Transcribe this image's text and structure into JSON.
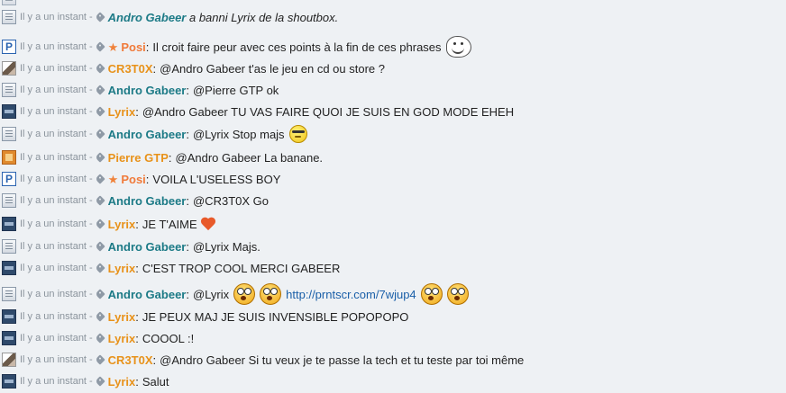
{
  "shoutbox": {
    "messages": [
      {
        "id": "r0",
        "avatar": "andro",
        "time": "Il y a un instant",
        "star": false,
        "user": "Andro Gabeer",
        "user_class": "u-andro",
        "italic": true,
        "text": "a banni Lyrix de la shoutbox.",
        "parts": []
      },
      {
        "id": "r1",
        "avatar": "posi",
        "time": "Il y a un instant",
        "star": true,
        "user": "Posi",
        "user_class": "u-posi",
        "italic": false,
        "text": "Il croit faire peur avec ces points à la fin de ces phrases",
        "parts": [
          {
            "type": "emoji",
            "icon": "troll-face-icon"
          }
        ]
      },
      {
        "id": "r2",
        "avatar": "cr3t0x",
        "time": "Il y a un instant",
        "star": false,
        "user": "CR3T0X",
        "user_class": "u-cr3t0x",
        "italic": false,
        "text": "@Andro Gabeer t'as le jeu en cd ou store ?",
        "parts": []
      },
      {
        "id": "r3",
        "avatar": "andro",
        "time": "Il y a un instant",
        "star": false,
        "user": "Andro Gabeer",
        "user_class": "u-andro",
        "italic": false,
        "text": "@Pierre GTP ok",
        "parts": []
      },
      {
        "id": "r4",
        "avatar": "lyrix",
        "time": "Il y a un instant",
        "star": false,
        "user": "Lyrix",
        "user_class": "u-lyrix",
        "italic": false,
        "text": "@Andro Gabeer TU VAS FAIRE QUOI JE SUIS EN GOD MODE EHEH",
        "parts": []
      },
      {
        "id": "r5",
        "avatar": "andro",
        "time": "Il y a un instant",
        "star": false,
        "user": "Andro Gabeer",
        "user_class": "u-andro",
        "italic": false,
        "text": "@Lyrix Stop majs",
        "parts": [
          {
            "type": "emoji",
            "icon": "cool-smiley-icon"
          }
        ]
      },
      {
        "id": "r6",
        "avatar": "pierre",
        "time": "Il y a un instant",
        "star": false,
        "user": "Pierre GTP",
        "user_class": "u-pierre",
        "italic": false,
        "text": "@Andro Gabeer La banane.",
        "parts": []
      },
      {
        "id": "r7",
        "avatar": "posi",
        "time": "Il y a un instant",
        "star": true,
        "user": "Posi",
        "user_class": "u-posi",
        "italic": false,
        "text": "VOILA L'USELESS BOY",
        "parts": []
      },
      {
        "id": "r8",
        "avatar": "andro",
        "time": "Il y a un instant",
        "star": false,
        "user": "Andro Gabeer",
        "user_class": "u-andro",
        "italic": false,
        "text": "@CR3T0X Go",
        "parts": []
      },
      {
        "id": "r9",
        "avatar": "lyrix",
        "time": "Il y a un instant",
        "star": false,
        "user": "Lyrix",
        "user_class": "u-lyrix",
        "italic": false,
        "text": "JE T'AIME",
        "parts": [
          {
            "type": "emoji",
            "icon": "heart-icon"
          }
        ]
      },
      {
        "id": "r10",
        "avatar": "andro",
        "time": "Il y a un instant",
        "star": false,
        "user": "Andro Gabeer",
        "user_class": "u-andro",
        "italic": false,
        "text": "@Lyrix Majs.",
        "parts": []
      },
      {
        "id": "r11",
        "avatar": "lyrix",
        "time": "Il y a un instant",
        "star": false,
        "user": "Lyrix",
        "user_class": "u-lyrix",
        "italic": false,
        "text": "C'EST TROP COOL MERCI GABEER",
        "parts": []
      },
      {
        "id": "r12",
        "avatar": "andro",
        "time": "Il y a un instant",
        "star": false,
        "user": "Andro Gabeer",
        "user_class": "u-andro",
        "italic": false,
        "text": "@Lyrix",
        "parts": [
          {
            "type": "emoji",
            "icon": "shocked-smiley-icon"
          },
          {
            "type": "emoji",
            "icon": "shocked-smiley-icon"
          },
          {
            "type": "link",
            "text": "http://prntscr.com/7wjup4"
          },
          {
            "type": "emoji",
            "icon": "shocked-smiley-icon"
          },
          {
            "type": "emoji",
            "icon": "shocked-smiley-icon"
          }
        ]
      },
      {
        "id": "r13",
        "avatar": "lyrix",
        "time": "Il y a un instant",
        "star": false,
        "user": "Lyrix",
        "user_class": "u-lyrix",
        "italic": false,
        "text": "JE PEUX MAJ JE SUIS INVENSIBLE POPOPOPO",
        "parts": []
      },
      {
        "id": "r14",
        "avatar": "lyrix",
        "time": "Il y a un instant",
        "star": false,
        "user": "Lyrix",
        "user_class": "u-lyrix",
        "italic": false,
        "text": "COOOL :!",
        "parts": []
      },
      {
        "id": "r15",
        "avatar": "cr3t0x",
        "time": "Il y a un instant",
        "star": false,
        "user": "CR3T0X",
        "user_class": "u-cr3t0x",
        "italic": false,
        "text": "@Andro Gabeer Si tu veux je te passe la tech et tu teste par toi même",
        "parts": []
      },
      {
        "id": "r16",
        "avatar": "lyrix",
        "time": "Il y a un instant",
        "star": false,
        "user": "Lyrix",
        "user_class": "u-lyrix",
        "italic": false,
        "text": "Salut",
        "parts": []
      }
    ]
  },
  "colors": {
    "background": "#eef1f4",
    "username_teal": "#1c7a86",
    "username_orange": "#e8921a",
    "staff_orange": "#f07a3a",
    "timestamp_gray": "#8a939c",
    "link_blue": "#1a5fa8"
  }
}
